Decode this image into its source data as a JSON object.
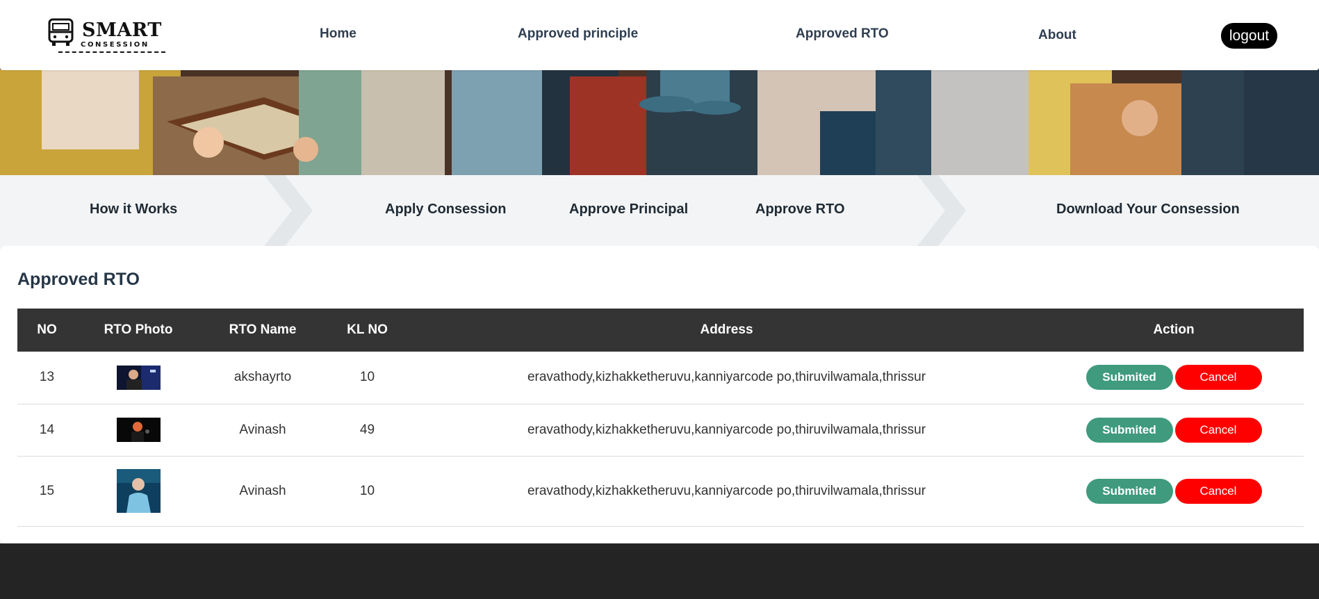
{
  "brand": {
    "main": "SMART",
    "sub": "CONSESSION"
  },
  "nav": {
    "home": "Home",
    "approved_principle": "Approved principle",
    "approved_rto": "Approved RTO",
    "about": "About",
    "logout": "logout"
  },
  "steps": {
    "how": "How it Works",
    "apply": "Apply Consession",
    "principal": "Approve Principal",
    "rto": "Approve RTO",
    "download": "Download Your Consession"
  },
  "page": {
    "title": "Approved RTO"
  },
  "table": {
    "headers": [
      "NO",
      "RTO Photo",
      "RTO Name",
      "KL NO",
      "Address",
      "Action"
    ],
    "rows": [
      {
        "no": "13",
        "name": "akshayrto",
        "kl": "10",
        "address": "eravathody,kizhakketheruvu,kanniyarcode po,thiruvilwamala,thrissur",
        "submit": "Submited",
        "cancel": "Cancel"
      },
      {
        "no": "14",
        "name": "Avinash",
        "kl": "49",
        "address": "eravathody,kizhakketheruvu,kanniyarcode po,thiruvilwamala,thrissur",
        "submit": "Submited",
        "cancel": "Cancel"
      },
      {
        "no": "15",
        "name": "Avinash",
        "kl": "10",
        "address": "eravathody,kizhakketheruvu,kanniyarcode po,thiruvilwamala,thrissur",
        "submit": "Submited",
        "cancel": "Cancel"
      }
    ]
  },
  "colors": {
    "accent_green": "#3f9a7e",
    "cancel_red": "#ff0000",
    "table_header": "#343434",
    "footer": "#242424"
  },
  "icons": {
    "logo": "bus-icon"
  }
}
